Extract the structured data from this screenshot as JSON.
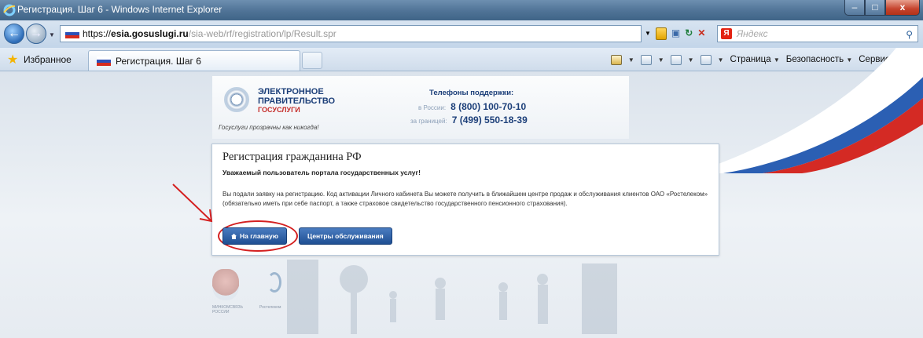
{
  "window": {
    "title": "Регистрация. Шаг 6 - Windows Internet Explorer",
    "minimize": "–",
    "maximize": "□",
    "close": "x"
  },
  "address_bar": {
    "protocol": "https://",
    "domain": "esia.gosuslugi.ru",
    "path": "/sia-web/rf/registration/lp/Result.spr",
    "search_placeholder": "Яндекс"
  },
  "favorites": {
    "label": "Избранное",
    "tab_label": "Регистрация. Шаг 6"
  },
  "command_bar": {
    "page": "Страница",
    "security": "Безопасность",
    "service": "Сервис"
  },
  "header": {
    "brand_line1": "ЭЛЕКТРОННОЕ",
    "brand_line2": "ПРАВИТЕЛЬСТВО",
    "brand_line3": "ГОСУСЛУГИ",
    "slogan": "Госуслуги прозрачны как никогда!",
    "support_title": "Телефоны поддержки:",
    "support_russia_label": "в России:",
    "support_russia_number": "8 (800) 100-70-10",
    "support_abroad_label": "за границей:",
    "support_abroad_number": "7 (499) 550-18-39"
  },
  "card": {
    "title": "Регистрация гражданина РФ",
    "subtitle": "Уважаемый пользователь портала государственных услуг!",
    "body": "Вы подали заявку на регистрацию. Код активации Личного кабинета Вы можете получить в ближайшем центре продаж и обслуживания клиентов ОАО «Ростелеком» (обязательно иметь при себе паспорт, а также страховое свидетельство государственного пенсионного страхования).",
    "home_button": "На главную",
    "centers_button": "Центры обслуживания"
  },
  "footer": {
    "minsvyaz_label": "МИНКОМСВЯЗЬ РОССИИ",
    "rostelecom_label": "Ростелеком"
  },
  "colors": {
    "brand_blue": "#1c3f79",
    "brand_red": "#c42a27",
    "button_blue": "#1f4f93",
    "annotation_red": "#d42020"
  }
}
